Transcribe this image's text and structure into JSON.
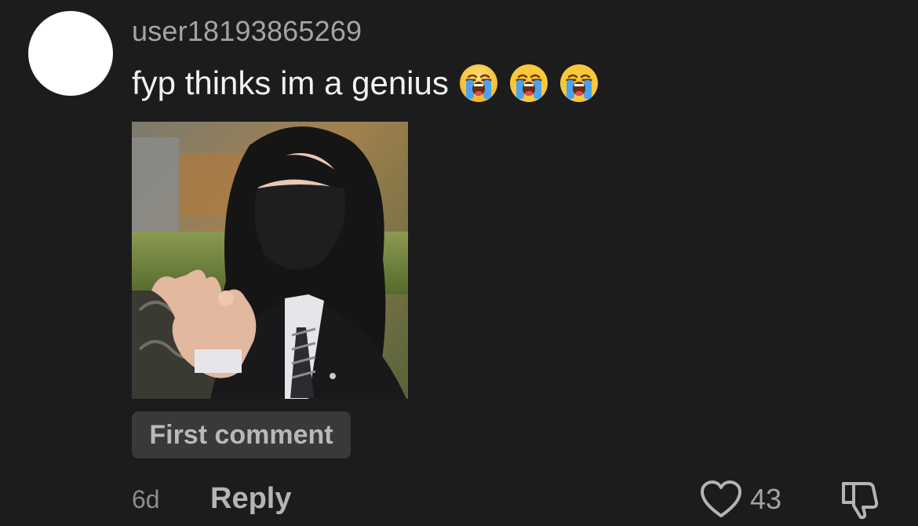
{
  "comment": {
    "username": "user18193865269",
    "text": "fyp thinks im a genius",
    "emojis": [
      "loudly-crying-face",
      "loudly-crying-face",
      "loudly-crying-face"
    ],
    "image_description_icon": "photo-attachment",
    "badge_label": "First comment",
    "time_ago": "6d",
    "reply_label": "Reply",
    "like_count": "43"
  },
  "colors": {
    "background": "#1c1c1d",
    "username": "#a4a4a6",
    "text": "#f2f2f2",
    "badge_bg": "#39393a",
    "muted": "#8c8c8e"
  },
  "icons": {
    "like": "heart-outline-icon",
    "dislike": "thumbs-down-outline-icon"
  }
}
